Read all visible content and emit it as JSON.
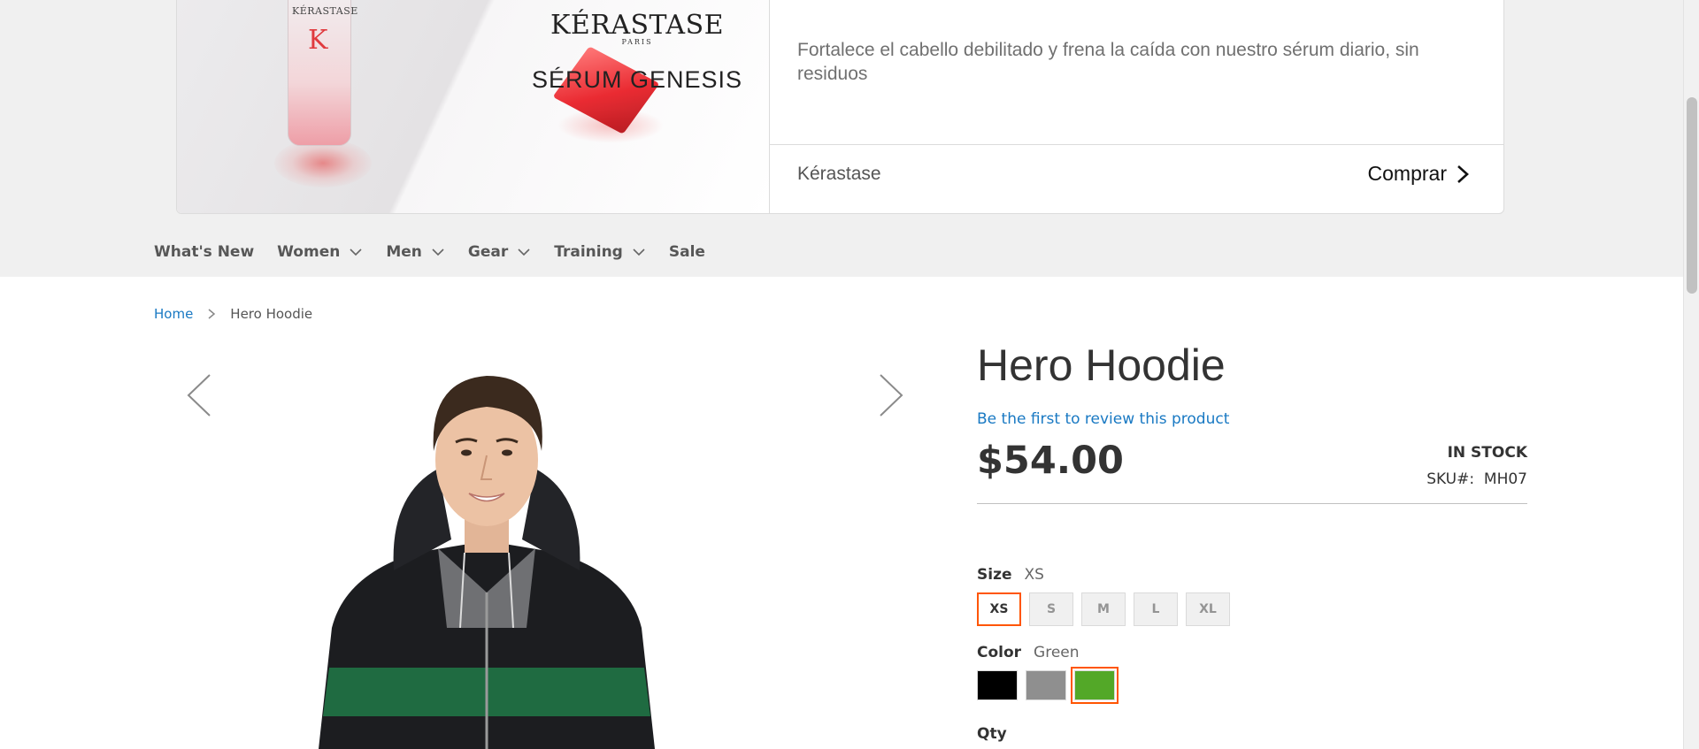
{
  "ad": {
    "brand_logo": "KÉRASTASE",
    "brand_logo_sub": "PARIS",
    "bottle_brand": "KÉRASTASE",
    "bottle_letter": "K",
    "headline": "SÉRUM GENESIS",
    "description": "Fortalece el cabello debilitado y frena la caída con nuestro sérum diario, sin residuos",
    "advertiser": "Kérastase",
    "cta_label": "Comprar"
  },
  "nav": {
    "items": [
      {
        "label": "What's New",
        "has_dropdown": false
      },
      {
        "label": "Women",
        "has_dropdown": true
      },
      {
        "label": "Men",
        "has_dropdown": true
      },
      {
        "label": "Gear",
        "has_dropdown": true
      },
      {
        "label": "Training",
        "has_dropdown": true
      },
      {
        "label": "Sale",
        "has_dropdown": false
      }
    ]
  },
  "breadcrumb": {
    "home": "Home",
    "current": "Hero Hoodie"
  },
  "product": {
    "title": "Hero Hoodie",
    "review_link": "Be the first to review this product",
    "price": "$54.00",
    "stock": "IN STOCK",
    "sku_label": "SKU#:",
    "sku": "MH07",
    "size": {
      "label": "Size",
      "selected": "XS",
      "options": [
        "XS",
        "S",
        "M",
        "L",
        "XL"
      ]
    },
    "color": {
      "label": "Color",
      "selected": "Green",
      "options": [
        {
          "name": "Black",
          "hex": "#000000"
        },
        {
          "name": "Gray",
          "hex": "#8f8f8f"
        },
        {
          "name": "Green",
          "hex": "#53a828"
        }
      ]
    },
    "qty_label": "Qty"
  },
  "colors": {
    "accent": "#ff5501",
    "link": "#1979c3",
    "band": "#f0f0f0"
  }
}
